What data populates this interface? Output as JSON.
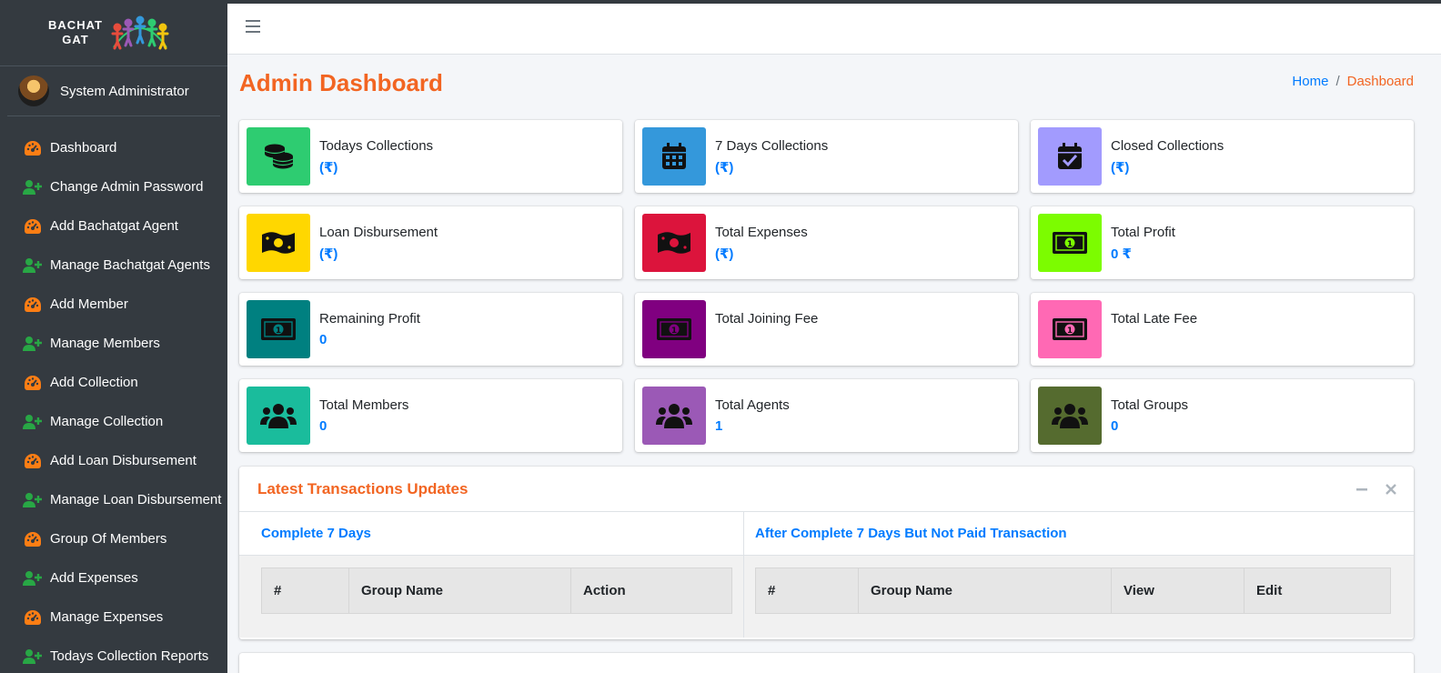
{
  "brand": {
    "name_line1": "BACHAT",
    "name_line2": "GAT"
  },
  "user": {
    "name": "System Administrator"
  },
  "sidebar": {
    "items": [
      {
        "label": "Dashboard",
        "icon": "tachometer-icon"
      },
      {
        "label": "Change Admin Password",
        "icon": "user-plus-icon"
      },
      {
        "label": "Add Bachatgat Agent",
        "icon": "tachometer-icon"
      },
      {
        "label": "Manage Bachatgat Agents",
        "icon": "user-plus-icon"
      },
      {
        "label": "Add Member",
        "icon": "tachometer-icon"
      },
      {
        "label": "Manage Members",
        "icon": "user-plus-icon"
      },
      {
        "label": "Add Collection",
        "icon": "tachometer-icon"
      },
      {
        "label": "Manage Collection",
        "icon": "user-plus-icon"
      },
      {
        "label": "Add Loan Disbursement",
        "icon": "tachometer-icon"
      },
      {
        "label": "Manage Loan Disbursement",
        "icon": "user-plus-icon"
      },
      {
        "label": "Group Of Members",
        "icon": "tachometer-icon"
      },
      {
        "label": "Add Expenses",
        "icon": "user-plus-icon"
      },
      {
        "label": "Manage Expenses",
        "icon": "tachometer-icon"
      },
      {
        "label": "Todays Collection Reports",
        "icon": "user-plus-icon"
      }
    ]
  },
  "page": {
    "title": "Admin Dashboard"
  },
  "breadcrumb": {
    "home": "Home",
    "separator": "/",
    "active": "Dashboard"
  },
  "boxes": [
    {
      "label": "Todays Collections",
      "value": "(₹)",
      "icon": "coins-icon",
      "color": "#2ecc71"
    },
    {
      "label": "7 Days Collections",
      "value": "(₹)",
      "icon": "calendar-icon",
      "color": "#3498db"
    },
    {
      "label": "Closed Collections",
      "value": "(₹)",
      "icon": "calendar-check-icon",
      "color": "#a29bfe"
    },
    {
      "label": "Loan Disbursement",
      "value": "(₹)",
      "icon": "money-bill-wave-icon",
      "color": "#ffd700"
    },
    {
      "label": "Total Expenses",
      "value": "(₹)",
      "icon": "money-bill-wave-icon",
      "color": "#dc143c"
    },
    {
      "label": "Total Profit",
      "value": "0 ₹",
      "icon": "money-bill-icon",
      "color": "#7cfc00"
    },
    {
      "label": "Remaining Profit",
      "value": "0",
      "icon": "money-bill-icon",
      "color": "#008080"
    },
    {
      "label": "Total Joining Fee",
      "value": "",
      "icon": "money-bill-icon",
      "color": "#800080"
    },
    {
      "label": "Total Late Fee",
      "value": "",
      "icon": "money-bill-icon",
      "color": "#ff69b4"
    },
    {
      "label": "Total Members",
      "value": "0",
      "icon": "users-icon",
      "color": "#1abc9c"
    },
    {
      "label": "Total Agents",
      "value": "1",
      "icon": "users-icon",
      "color": "#9b59b6"
    },
    {
      "label": "Total Groups",
      "value": "0",
      "icon": "users-icon",
      "color": "#556b2f"
    }
  ],
  "transactions": {
    "title": "Latest Transactions Updates",
    "left": {
      "heading": "Complete 7 Days",
      "columns": [
        "#",
        "Group Name",
        "Action"
      ]
    },
    "right": {
      "heading": "After Complete 7 Days But Not Paid Transaction",
      "columns": [
        "#",
        "Group Name",
        "View",
        "Edit"
      ]
    }
  },
  "colors": {
    "accent": "#f26522",
    "link": "#007bff",
    "sidebar_bg": "#343a40",
    "sidebar_icon_orange": "#fd7e14",
    "sidebar_icon_green": "#28a745"
  }
}
